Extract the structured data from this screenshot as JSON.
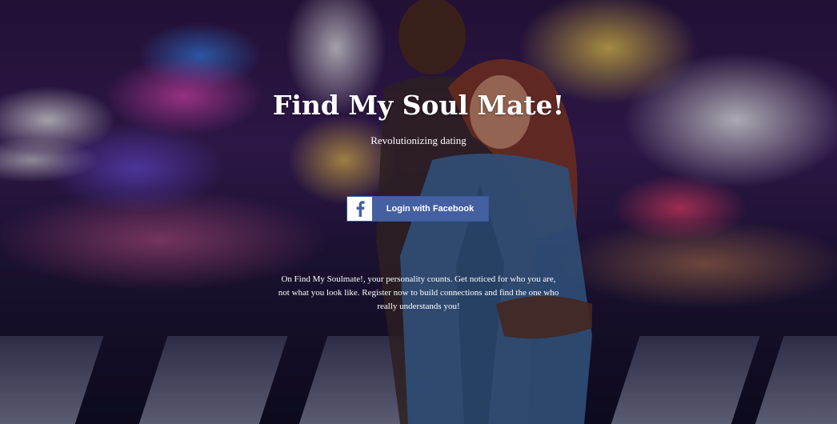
{
  "hero": {
    "title": "Find My Soul Mate!",
    "subtitle": "Revolutionizing dating",
    "description": "On Find My Soulmate!, your personality counts. Get noticed for who you are, not what you look like. Register now to build connections and find the one who really understands you!"
  },
  "login_button": {
    "label": "Login with Facebook",
    "icon": "facebook-icon",
    "color": "#4460a0"
  },
  "background": {
    "image": "couple-walking-city-night-photo"
  },
  "colors": {
    "text": "#ffffff",
    "facebook_blue": "#4460a0"
  }
}
